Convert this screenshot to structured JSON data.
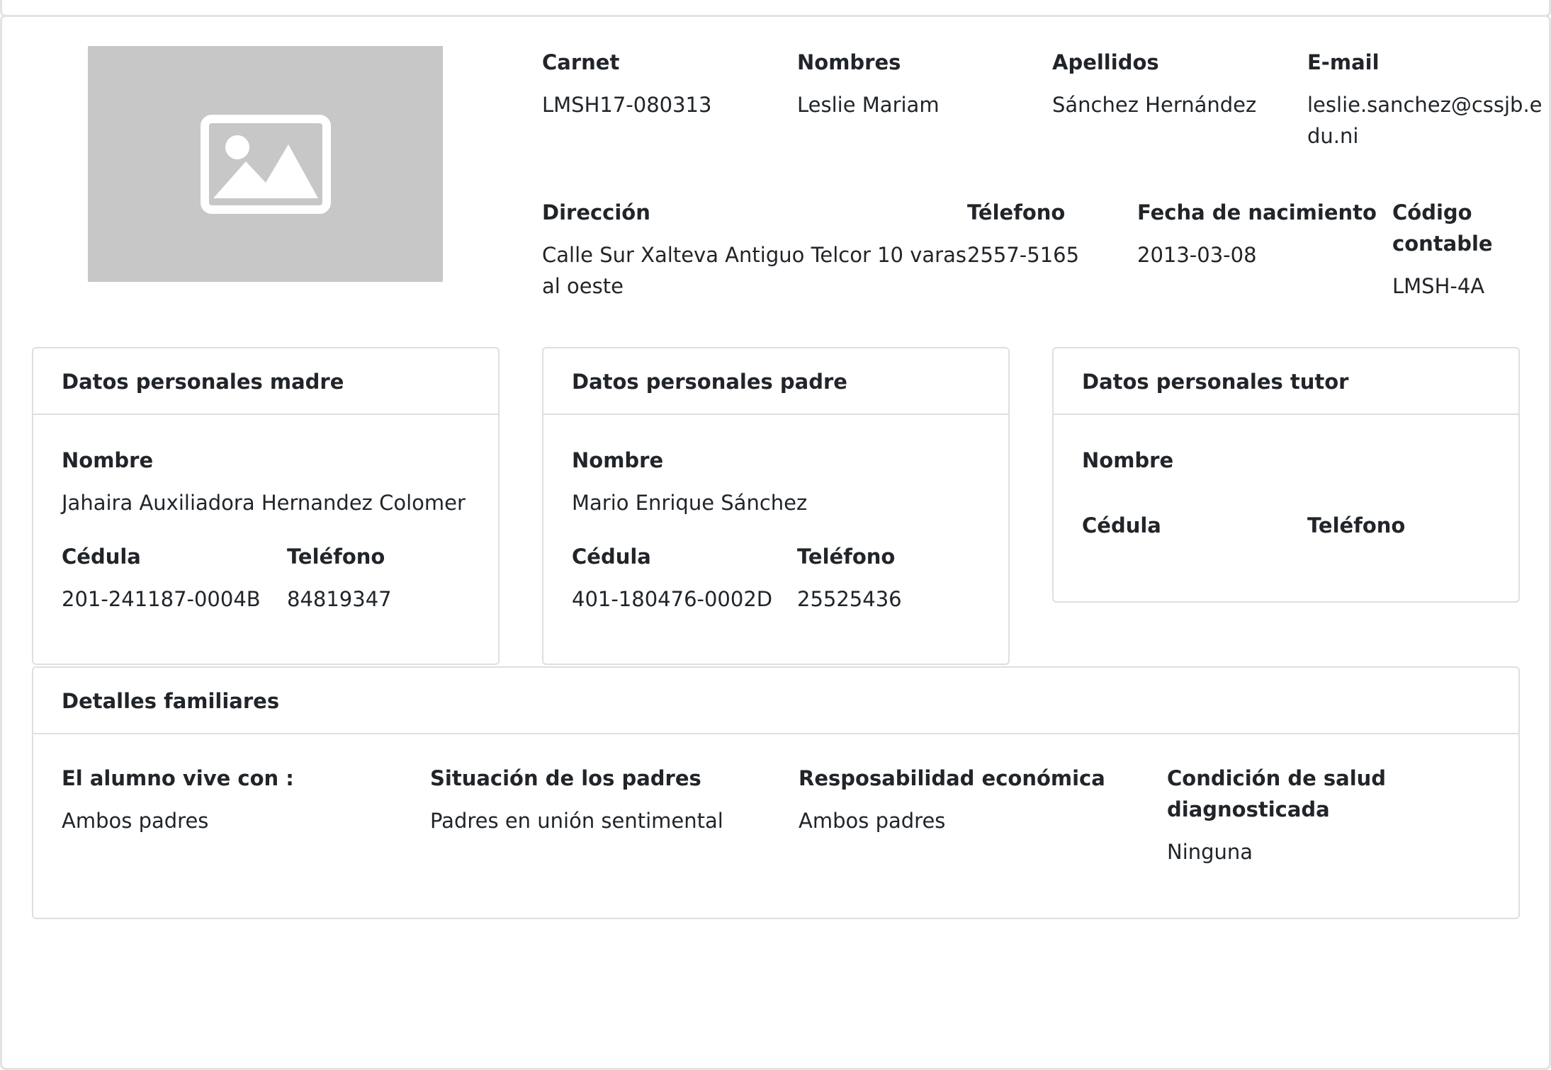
{
  "student": {
    "photo_icon": "image-placeholder-icon",
    "carnet_label": "Carnet",
    "carnet": "LMSH17-080313",
    "nombres_label": "Nombres",
    "nombres": "Leslie Mariam",
    "apellidos_label": "Apellidos",
    "apellidos": "Sánchez Hernández",
    "email_label": "E-mail",
    "email_line1": "leslie.sanchez@cssjb.e",
    "email_line2": "du.ni",
    "direccion_label": "Dirección",
    "direccion_line1": "Calle Sur Xalteva Antiguo Telcor 10 varas",
    "direccion_line2": "al oeste",
    "telefono_label": "Télefono",
    "telefono": "2557-5165",
    "nacimiento_label": "Fecha de nacimiento",
    "nacimiento": "2013-03-08",
    "codigo_label_line1": "Código",
    "codigo_label_line2": "contable",
    "codigo": "LMSH-4A"
  },
  "madre": {
    "title": "Datos personales madre",
    "nombre_label": "Nombre",
    "nombre": "Jahaira Auxiliadora Hernandez Colomer",
    "cedula_label": "Cédula",
    "cedula": "201-241187-0004B",
    "telefono_label": "Teléfono",
    "telefono": "84819347"
  },
  "padre": {
    "title": "Datos personales padre",
    "nombre_label": "Nombre",
    "nombre": "Mario Enrique Sánchez",
    "cedula_label": "Cédula",
    "cedula": "401-180476-0002D",
    "telefono_label": "Teléfono",
    "telefono": "25525436"
  },
  "tutor": {
    "title": "Datos personales tutor",
    "nombre_label": "Nombre",
    "cedula_label": "Cédula",
    "telefono_label": "Teléfono"
  },
  "familia": {
    "title": "Detalles familiares",
    "vive_label": "El alumno vive con :",
    "vive": "Ambos padres",
    "situacion_label": "Situación de los padres",
    "situacion": "Padres en unión sentimental",
    "responsabilidad_label": "Resposabilidad económica",
    "responsabilidad": "Ambos padres",
    "salud_label_line1": "Condición de salud",
    "salud_label_line2": "diagnosticada",
    "salud": "Ninguna"
  }
}
